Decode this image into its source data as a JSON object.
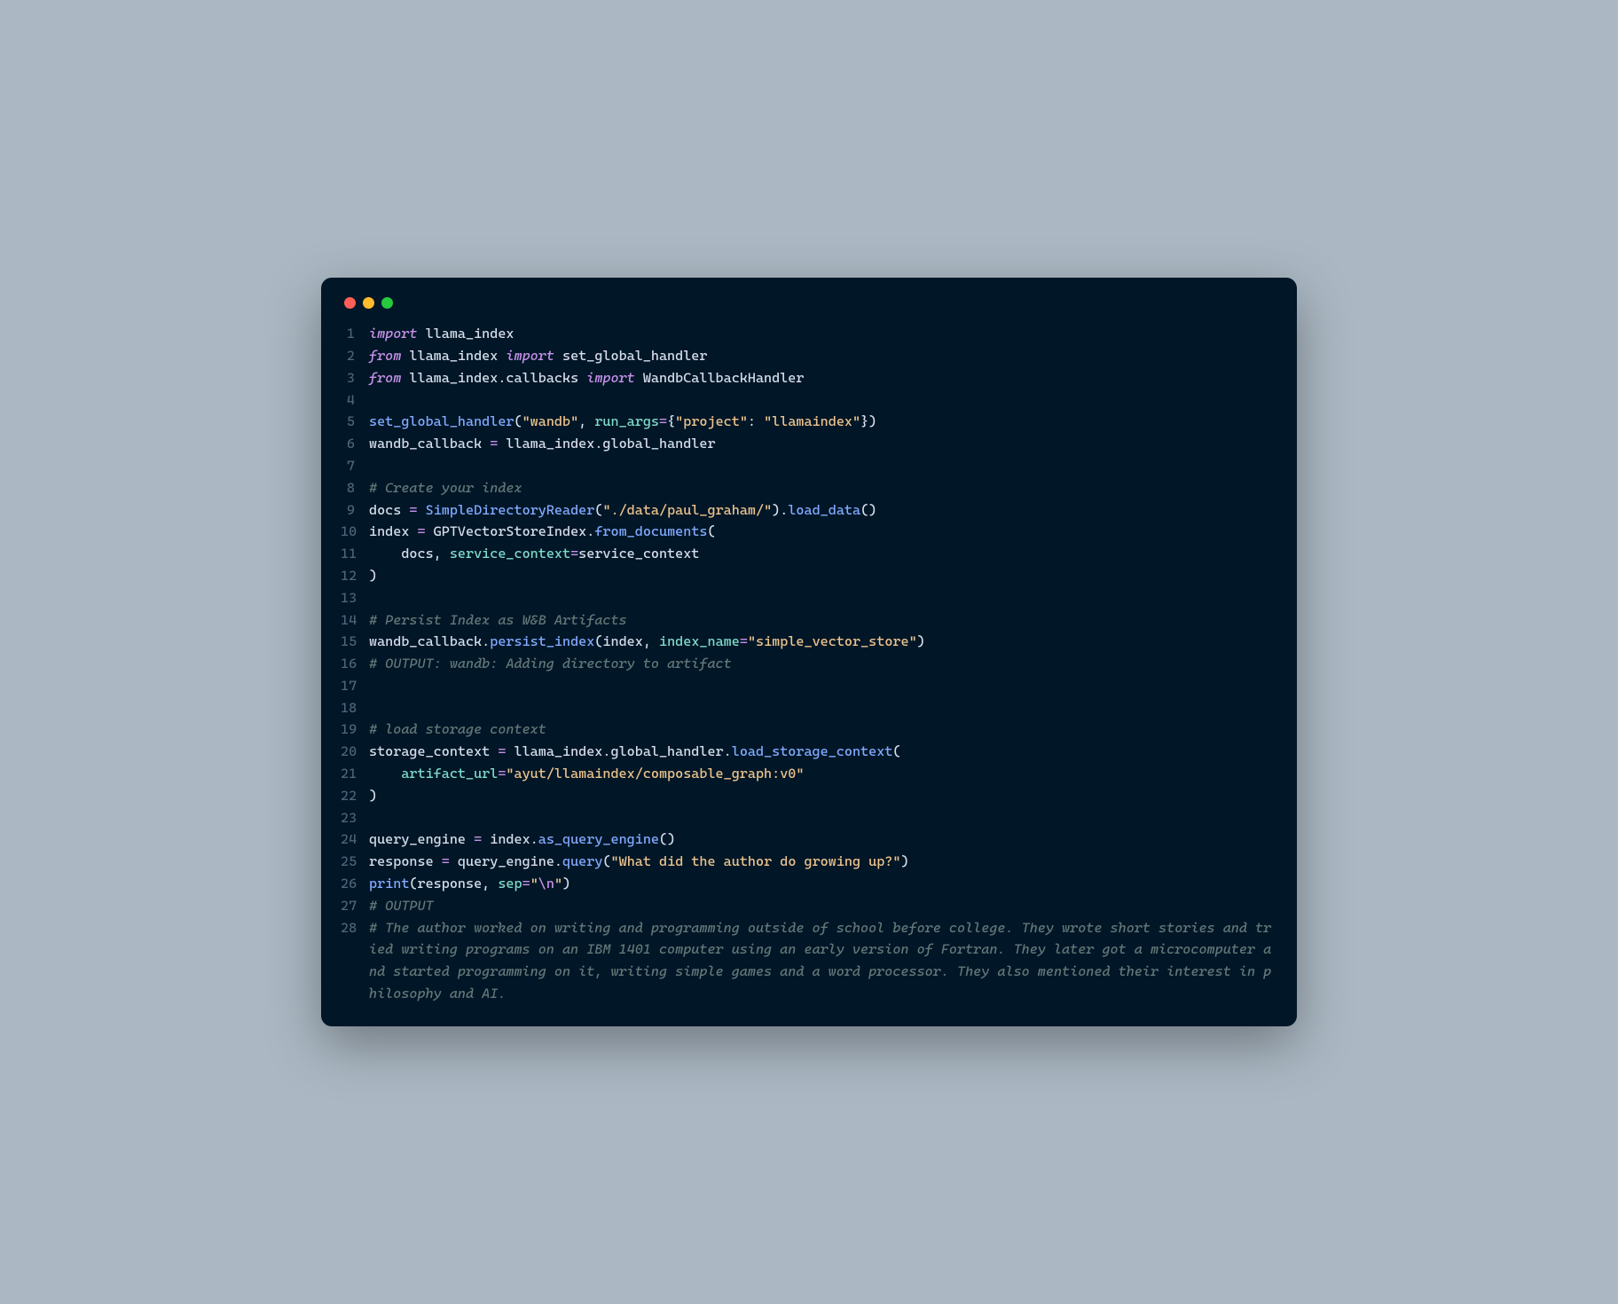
{
  "colors": {
    "traffic_red": "#ff5f56",
    "traffic_yellow": "#ffbd2e",
    "traffic_green": "#27c93f",
    "bg": "#011627",
    "page": "#abb8c3"
  },
  "gutter": [
    "1",
    "2",
    "3",
    "4",
    "5",
    "6",
    "7",
    "8",
    "9",
    "10",
    "11",
    "12",
    "13",
    "14",
    "15",
    "16",
    "17",
    "18",
    "19",
    "20",
    "21",
    "22",
    "23",
    "24",
    "25",
    "26",
    "27",
    "28"
  ],
  "code": {
    "l1": {
      "kw1": "import",
      "id1": " llama_index"
    },
    "l2": {
      "kw1": "from",
      "id1": " llama_index ",
      "kw2": "import",
      "id2": " set_global_handler"
    },
    "l3": {
      "kw1": "from",
      "id1": " llama_index",
      "punct1": ".",
      "id2": "callbacks ",
      "kw2": "import",
      "id3": " WandbCallbackHandler"
    },
    "l5": {
      "fn1": "set_global_handler",
      "punct1": "(",
      "str1": "\"wandb\"",
      "punct2": ", ",
      "param1": "run_args",
      "op1": "=",
      "punct3": "{",
      "str2": "\"project\"",
      "punct4": ": ",
      "str3": "\"llamaindex\"",
      "punct5": "})"
    },
    "l6": {
      "id1": "wandb_callback ",
      "op1": "=",
      "id2": " llama_index",
      "punct1": ".",
      "id3": "global_handler"
    },
    "l8": {
      "cmt1": "# Create your index"
    },
    "l9": {
      "id1": "docs ",
      "op1": "=",
      "id2": " ",
      "fn1": "SimpleDirectoryReader",
      "punct1": "(",
      "str1": "\"./data/paul_graham/\"",
      "punct2": ").",
      "fn2": "load_data",
      "punct3": "()"
    },
    "l10": {
      "id1": "index ",
      "op1": "=",
      "id2": " GPTVectorStoreIndex",
      "punct1": ".",
      "fn1": "from_documents",
      "punct2": "("
    },
    "l11": {
      "indent": "    ",
      "id1": "docs",
      "punct1": ", ",
      "param1": "service_context",
      "op1": "=",
      "id2": "service_context"
    },
    "l12": {
      "punct1": ")"
    },
    "l14": {
      "cmt1": "# Persist Index as W&B Artifacts"
    },
    "l15": {
      "id1": "wandb_callback",
      "punct1": ".",
      "fn1": "persist_index",
      "punct2": "(",
      "id2": "index",
      "punct3": ", ",
      "param1": "index_name",
      "op1": "=",
      "str1": "\"simple_vector_store\"",
      "punct4": ")"
    },
    "l16": {
      "cmt1": "# OUTPUT: wandb: Adding directory to artifact"
    },
    "l19": {
      "cmt1": "# load storage context"
    },
    "l20": {
      "id1": "storage_context ",
      "op1": "=",
      "id2": " llama_index",
      "punct1": ".",
      "id3": "global_handler",
      "punct2": ".",
      "fn1": "load_storage_context",
      "punct3": "("
    },
    "l21": {
      "indent": "    ",
      "param1": "artifact_url",
      "op1": "=",
      "str1": "\"ayut/llamaindex/composable_graph:v0\""
    },
    "l22": {
      "punct1": ")"
    },
    "l24": {
      "id1": "query_engine ",
      "op1": "=",
      "id2": " index",
      "punct1": ".",
      "fn1": "as_query_engine",
      "punct2": "()"
    },
    "l25": {
      "id1": "response ",
      "op1": "=",
      "id2": " query_engine",
      "punct1": ".",
      "fn1": "query",
      "punct2": "(",
      "str1": "\"What did the author do growing up?\"",
      "punct3": ")"
    },
    "l26": {
      "fn1": "print",
      "punct1": "(",
      "id1": "response",
      "punct2": ", ",
      "param1": "sep",
      "op1": "=",
      "str1_a": "\"",
      "esc1": "\\n",
      "str1_b": "\"",
      "punct3": ")"
    },
    "l27": {
      "cmt1": "# OUTPUT"
    },
    "l28": {
      "cmt1": "# The author worked on writing and programming outside of school before college. They wrote short stories and tried writing programs on an IBM 1401 computer using an early version of Fortran. They later got a microcomputer and started programming on it, writing simple games and a word processor. They also mentioned their interest in philosophy and AI."
    }
  }
}
